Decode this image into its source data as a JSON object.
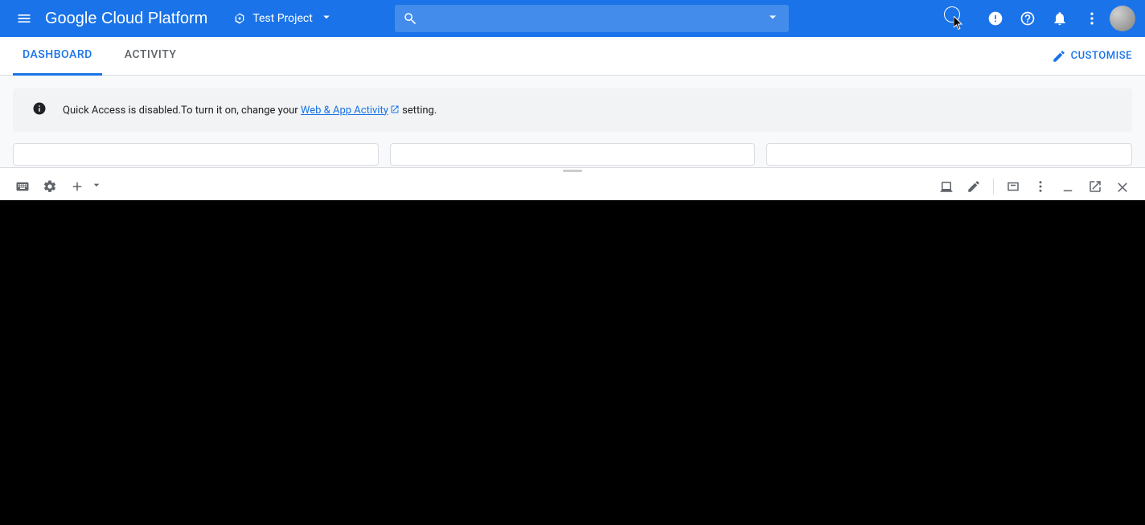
{
  "header": {
    "logo_text": "Google Cloud Platform",
    "project_name": "Test Project"
  },
  "tabs": {
    "dashboard": "DASHBOARD",
    "activity": "ACTIVITY",
    "customise": "CUSTOMISE"
  },
  "notice": {
    "text_before": "Quick Access is disabled.To turn it on, change your ",
    "link_text": "Web & App Activity",
    "text_after": " setting."
  },
  "colors": {
    "primary": "#1a73e8"
  }
}
